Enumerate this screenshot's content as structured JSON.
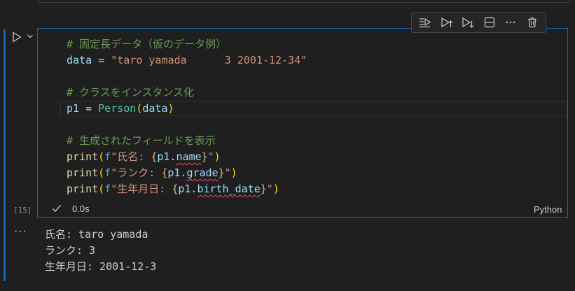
{
  "code_lines": [
    {
      "tokens": [
        {
          "t": "# 固定長データ（仮のデータ例）",
          "c": "c-comment"
        }
      ]
    },
    {
      "tokens": [
        {
          "t": "data",
          "c": "c-var"
        },
        {
          "t": " = ",
          "c": ""
        },
        {
          "t": "\"taro yamada      3 2001-12-34\"",
          "c": "c-str"
        }
      ]
    },
    {
      "tokens": []
    },
    {
      "tokens": [
        {
          "t": "# クラスをインスタンス化",
          "c": "c-comment"
        }
      ]
    },
    {
      "tokens": [
        {
          "t": "p1",
          "c": "c-var"
        },
        {
          "t": " = ",
          "c": ""
        },
        {
          "t": "Person",
          "c": "c-cls"
        },
        {
          "t": "(",
          "c": "c-paren"
        },
        {
          "t": "data",
          "c": "c-var"
        },
        {
          "t": ")",
          "c": "c-paren"
        }
      ]
    },
    {
      "tokens": []
    },
    {
      "tokens": [
        {
          "t": "# 生成されたフィールドを表示",
          "c": "c-comment"
        }
      ]
    },
    {
      "tokens": [
        {
          "t": "print",
          "c": "c-fn"
        },
        {
          "t": "(",
          "c": "c-paren"
        },
        {
          "t": "f",
          "c": "c-kw"
        },
        {
          "t": "\"氏名: ",
          "c": "c-str"
        },
        {
          "t": "{",
          "c": "c-brace"
        },
        {
          "t": "p1",
          "c": "c-var"
        },
        {
          "t": ".",
          "c": ""
        },
        {
          "t": "name",
          "c": "c-var squig"
        },
        {
          "t": "}",
          "c": "c-brace"
        },
        {
          "t": "\"",
          "c": "c-str"
        },
        {
          "t": ")",
          "c": "c-paren"
        }
      ]
    },
    {
      "tokens": [
        {
          "t": "print",
          "c": "c-fn"
        },
        {
          "t": "(",
          "c": "c-paren"
        },
        {
          "t": "f",
          "c": "c-kw"
        },
        {
          "t": "\"ランク: ",
          "c": "c-str"
        },
        {
          "t": "{",
          "c": "c-brace"
        },
        {
          "t": "p1",
          "c": "c-var"
        },
        {
          "t": ".",
          "c": ""
        },
        {
          "t": "grade",
          "c": "c-var squig"
        },
        {
          "t": "}",
          "c": "c-brace"
        },
        {
          "t": "\"",
          "c": "c-str"
        },
        {
          "t": ")",
          "c": "c-paren"
        }
      ]
    },
    {
      "tokens": [
        {
          "t": "print",
          "c": "c-fn"
        },
        {
          "t": "(",
          "c": "c-paren"
        },
        {
          "t": "f",
          "c": "c-kw"
        },
        {
          "t": "\"生年月日: ",
          "c": "c-str"
        },
        {
          "t": "{",
          "c": "c-brace"
        },
        {
          "t": "p1",
          "c": "c-var"
        },
        {
          "t": ".",
          "c": ""
        },
        {
          "t": "birth_date",
          "c": "c-var squig"
        },
        {
          "t": "}",
          "c": "c-brace"
        },
        {
          "t": "\"",
          "c": "c-str"
        },
        {
          "t": ")",
          "c": "c-paren"
        }
      ]
    }
  ],
  "cell": {
    "execution_count": "[15]",
    "status_time": "0.0s",
    "language": "Python"
  },
  "output": {
    "collapse_glyph": "···",
    "lines": [
      "氏名: taro yamada",
      "ランク: 3",
      "生年月日: 2001-12-3"
    ]
  },
  "toolbar": {
    "items": [
      "execute-above-icon",
      "run-cell-icon",
      "run-below-icon",
      "split-cell-icon",
      "more-icon",
      "delete-icon"
    ]
  },
  "colors": {
    "focus": "#0e68b8",
    "comment": "#6a9955",
    "string": "#ce9178",
    "class": "#4ec9b0"
  }
}
